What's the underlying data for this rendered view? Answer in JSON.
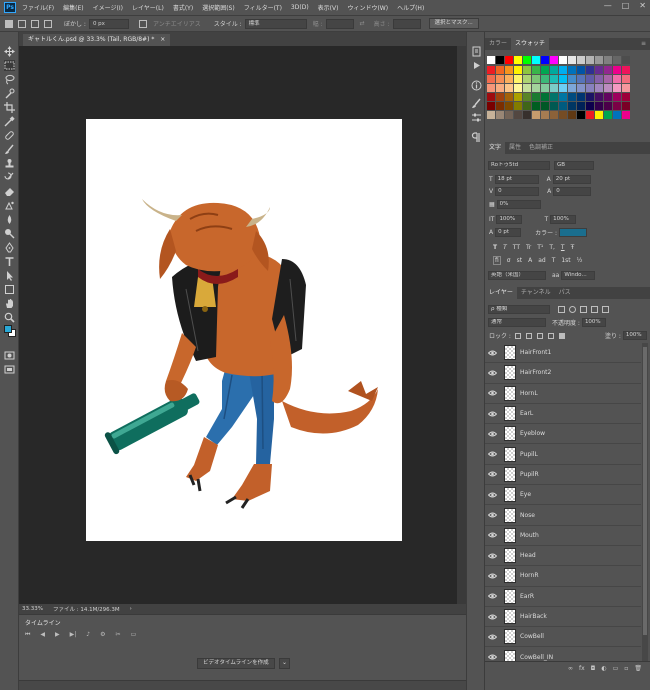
{
  "app": {
    "logo_text": "Ps"
  },
  "menu": [
    "ファイル(F)",
    "編集(E)",
    "イメージ(I)",
    "レイヤー(L)",
    "書式(Y)",
    "選択範囲(S)",
    "フィルター(T)",
    "3D(D)",
    "表示(V)",
    "ウィンドウ(W)",
    "ヘルプ(H)"
  ],
  "window_controls": {
    "minimize": "—",
    "maximize": "□",
    "close": "✕"
  },
  "options_bar": {
    "feather_label": "ぼかし :",
    "feather_value": "0 px",
    "antialias_label": "アンチエイリアス",
    "style_label": "スタイル :",
    "style_value": "標準",
    "width_label": "幅 :",
    "height_label": "高さ :",
    "select_mask_button": "選択とマスク..."
  },
  "document": {
    "tab_title": "ギャトルくん.psd @ 33.3% (Tail, RGB/8#) *",
    "tab_close": "×",
    "zoom": "33.33%",
    "file_info": "ファイル : 14.1M/296.3M",
    "status_arrow": "›"
  },
  "timeline": {
    "title": "タイムライン",
    "controls": [
      "⏮",
      "◀",
      "▶",
      "▶|",
      "♪",
      "⚙",
      "✂",
      "▭"
    ],
    "create_button": "ビデオタイムラインを作成",
    "dropdown_arrow": "⌄"
  },
  "swatches_panel": {
    "tabs": [
      "カラー",
      "スウォッチ"
    ],
    "active_tab": 1,
    "menu_icon": "≡",
    "top_row": [
      "#ffffff",
      "#000000",
      "#ff0000",
      "#ffff00",
      "#00ff00",
      "#00ffff",
      "#0000ff",
      "#ff00ff",
      "#ffffff",
      "#e6e6e6",
      "#cccccc",
      "#b3b3b3",
      "#999999",
      "#808080",
      "#666666",
      "#4d4d4d"
    ],
    "colors": [
      "#ed1c24",
      "#f26522",
      "#f7941d",
      "#fff200",
      "#8dc63f",
      "#39b54a",
      "#00a651",
      "#00a99d",
      "#00aeef",
      "#0072bc",
      "#0054a6",
      "#2e3192",
      "#662d91",
      "#92278f",
      "#ec008c",
      "#ed145b",
      "#f26c4f",
      "#f68e56",
      "#fbaf5d",
      "#fff568",
      "#acd373",
      "#7cc576",
      "#3bb878",
      "#1abbb4",
      "#00bff3",
      "#448ccb",
      "#5674b9",
      "#605ca8",
      "#8560a8",
      "#a864a8",
      "#f06eaa",
      "#f26d7d",
      "#f69679",
      "#f9ad81",
      "#fdc68a",
      "#fff79a",
      "#c4df9b",
      "#a3d39c",
      "#82ca9d",
      "#7accc8",
      "#6dcff6",
      "#7da7d9",
      "#8393ca",
      "#8781bd",
      "#a187be",
      "#bd8cbf",
      "#f49ac2",
      "#f5989d",
      "#9e0b0f",
      "#a0410d",
      "#a36209",
      "#aba000",
      "#598527",
      "#1a7b30",
      "#007236",
      "#00746b",
      "#0076a3",
      "#004b80",
      "#003471",
      "#1b1464",
      "#440e62",
      "#630460",
      "#9e005d",
      "#9e0039",
      "#790000",
      "#7b2e00",
      "#7d4900",
      "#827b00",
      "#406618",
      "#005e20",
      "#005826",
      "#005952",
      "#005b7f",
      "#003663",
      "#002157",
      "#0d004c",
      "#32004b",
      "#4b0049",
      "#7b0046",
      "#7a0026",
      "#c7b299",
      "#998675",
      "#736357",
      "#534741",
      "#37302d",
      "#c69c6d",
      "#a67c52",
      "#8c6239",
      "#754c24",
      "#603913",
      "#000000",
      "#ed1c24",
      "#fff200",
      "#00a651",
      "#0072bc",
      "#ec008c"
    ]
  },
  "character_panel": {
    "tabs": [
      "文字",
      "属性",
      "色調補正"
    ],
    "font_family": "Roトゥ5td",
    "font_style": "GB",
    "font_size": "18 pt",
    "leading": "20 pt",
    "kerning": "0",
    "tracking": "0",
    "tsume": "0%",
    "vscale": "100%",
    "hscale": "100%",
    "baseline": "0 pt",
    "color_label": "カラー :",
    "color_value": "#1a6e8e",
    "style_buttons": [
      "T",
      "T",
      "TT",
      "Tr",
      "T¹",
      "T,",
      "T",
      "Ŧ"
    ],
    "opentype_buttons": [
      "fi",
      "σ",
      "st",
      "A",
      "ad",
      "T",
      "1st",
      "½"
    ],
    "language": "英語（米国）",
    "aa_label": "aa",
    "aa_value": "Windo..."
  },
  "layers_panel": {
    "tabs": [
      "レイヤー",
      "チャンネル",
      "パス"
    ],
    "filter_label": "ρ 種類",
    "blend_mode": "通常",
    "opacity_label": "不透明度 :",
    "opacity_value": "100%",
    "lock_label": "ロック :",
    "fill_label": "塗り :",
    "fill_value": "100%",
    "layers": [
      "HairFront1",
      "HairFront2",
      "HornL",
      "EarL",
      "Eyeblow",
      "PupilL",
      "PupilR",
      "Eye",
      "Nose",
      "Mouth",
      "Head",
      "HornR",
      "EarR",
      "HairBack",
      "CowBell",
      "CowBell_IN"
    ],
    "bottom_icons": [
      "∞",
      "fx",
      "◘",
      "◐",
      "▭",
      "▫",
      "🗑"
    ]
  }
}
